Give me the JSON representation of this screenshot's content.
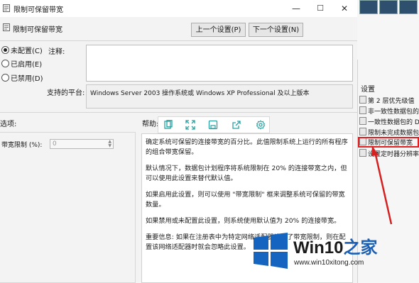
{
  "window": {
    "title": "限制可保留带宽",
    "minimize_glyph": "—",
    "maximize_glyph": "☐",
    "close_glyph": "✕"
  },
  "header": {
    "setting_name": "限制可保留带宽",
    "prev_button": "上一个设置(P)",
    "next_button": "下一个设置(N)"
  },
  "state": {
    "options": [
      {
        "label": "未配置(C)",
        "selected": true
      },
      {
        "label": "已启用(E)",
        "selected": false
      },
      {
        "label": "已禁用(D)",
        "selected": false
      }
    ]
  },
  "comment": {
    "label": "注释:",
    "value": ""
  },
  "platform": {
    "label": "支持的平台:",
    "value": "Windows Server 2003 操作系统或 Windows XP Professional 及以上版本"
  },
  "options_panel": {
    "label": "选项:",
    "field_label": "带宽限制 (%):",
    "field_value": "0"
  },
  "help_panel": {
    "label": "帮助:",
    "paragraphs": [
      "确定系统可保留的连接带宽的百分比。此值限制系统上运行的所有程序的组合带宽保留。",
      "默认情况下，数据包计划程序将系统限制在 20% 的连接带宽之内，但可以使用此设置来替代默认值。",
      "如果启用此设置，则可以使用 \"带宽限制\" 框来调整系统可保留的带宽数量。",
      "如果禁用或未配置此设置，则系统使用默认值为 20% 的连接带宽。",
      "重要信息: 如果在注册表中为特定网络适配器设置了带宽限制，则在配置该网络适配器时就会忽略此设置。"
    ]
  },
  "toolbar_icons": [
    "copy-icon",
    "expand-icon",
    "save-icon",
    "share-icon",
    "settings-icon"
  ],
  "right_pane": {
    "heading": "设置",
    "items": [
      "第 2 层优先级值",
      "非一致性数据包的...",
      "一致性数据包的 D...",
      "限制未完成数据包...",
      "限制可保留带宽",
      "设置定时器分辨率"
    ],
    "highlighted_index": 4
  },
  "watermark": {
    "title_prefix": "Win10",
    "title_suffix": "之家",
    "url": "www.win10xitong.com"
  },
  "colors": {
    "highlight": "#e02020",
    "logo_blue": "#1a5fb4",
    "toolbar_icon": "#2aa0a0"
  }
}
